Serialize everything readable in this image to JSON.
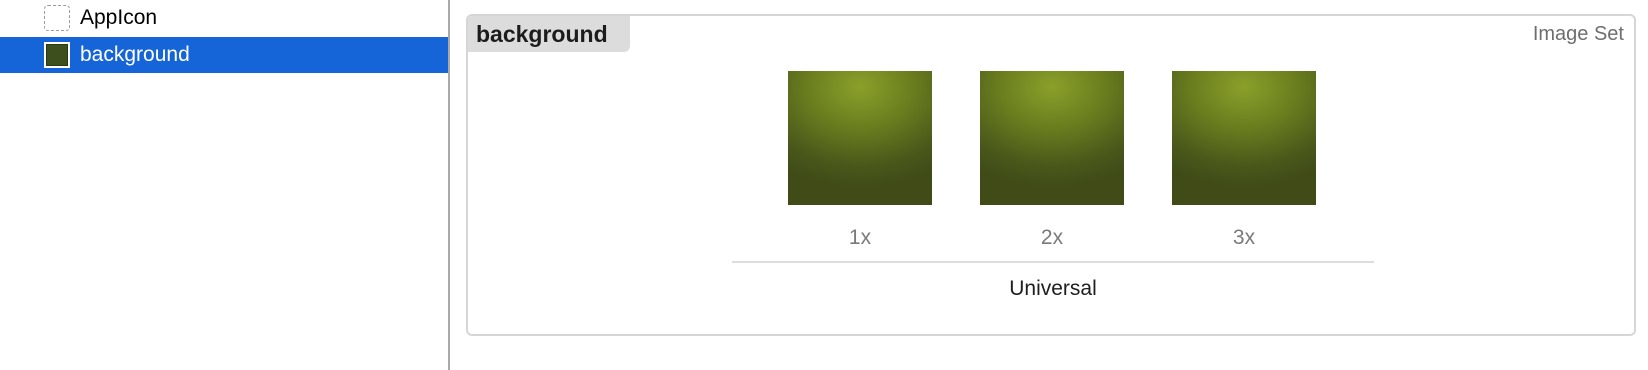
{
  "sidebar": {
    "items": [
      {
        "label": "AppIcon",
        "icon": "app-icon-set-icon",
        "selected": false
      },
      {
        "label": "background",
        "icon": "image-set-icon",
        "selected": true
      }
    ]
  },
  "editor": {
    "asset_name": "background",
    "asset_type": "Image Set",
    "slots": [
      {
        "scale": "1x"
      },
      {
        "scale": "2x"
      },
      {
        "scale": "3x"
      }
    ],
    "idiom": "Universal"
  },
  "colors": {
    "selection": "#1565d8",
    "swatch_center": "#8aa02a",
    "swatch_edge": "#404b18"
  }
}
